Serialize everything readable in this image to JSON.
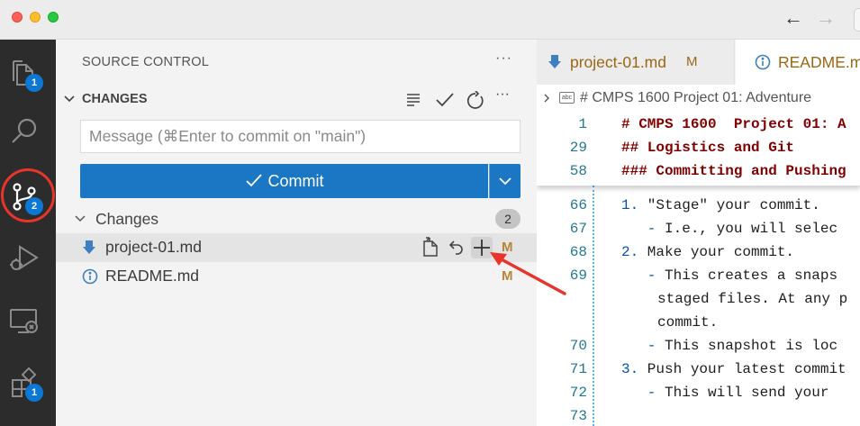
{
  "sidebar": {
    "title": "SOURCE CONTROL",
    "more": "···",
    "changes_header": "CHANGES",
    "message_placeholder": "Message (⌘Enter to commit on \"main\")",
    "commit_label": "Commit",
    "changes_group": "Changes",
    "changes_count": "2",
    "files": [
      {
        "name": "project-01.md",
        "status": "M"
      },
      {
        "name": "README.md",
        "status": "M"
      }
    ]
  },
  "activity": {
    "explorer_badge": "1",
    "scm_badge": "2",
    "extensions_badge": "1"
  },
  "tabs": [
    {
      "label": "project-01.md",
      "status": "M"
    },
    {
      "label": "README.md",
      "status": ""
    }
  ],
  "breadcrumb": "# CMPS 1600  Project 01: Adventure",
  "sticky": [
    {
      "ln": "1",
      "text": "# CMPS 1600  Project 01: A"
    },
    {
      "ln": "29",
      "text": "## Logistics and Git"
    },
    {
      "ln": "58",
      "text": "### Committing and Pushing"
    }
  ],
  "lines": [
    {
      "ln": "66",
      "marker": "1.",
      "text": " \"Stage\" your commit."
    },
    {
      "ln": "67",
      "marker": "   -",
      "text": " I.e., you will selec"
    },
    {
      "ln": "68",
      "marker": "2.",
      "text": " Make your commit."
    },
    {
      "ln": "69",
      "marker": "   -",
      "text": " This creates a snaps"
    },
    {
      "ln": "",
      "marker": "",
      "text": "staged files. At any p"
    },
    {
      "ln": "",
      "marker": "",
      "text": "commit."
    },
    {
      "ln": "70",
      "marker": "   -",
      "text": " This snapshot is loc"
    },
    {
      "ln": "71",
      "marker": "3.",
      "text": " Push your latest commit"
    },
    {
      "ln": "72",
      "marker": "   -",
      "text": " This will send your"
    },
    {
      "ln": "73",
      "marker": "",
      "text": ""
    }
  ],
  "colors": {
    "accent": "#1b76c4",
    "badge": "#0a78d4",
    "modified": "#b58436",
    "annotation": "#e8352b"
  }
}
